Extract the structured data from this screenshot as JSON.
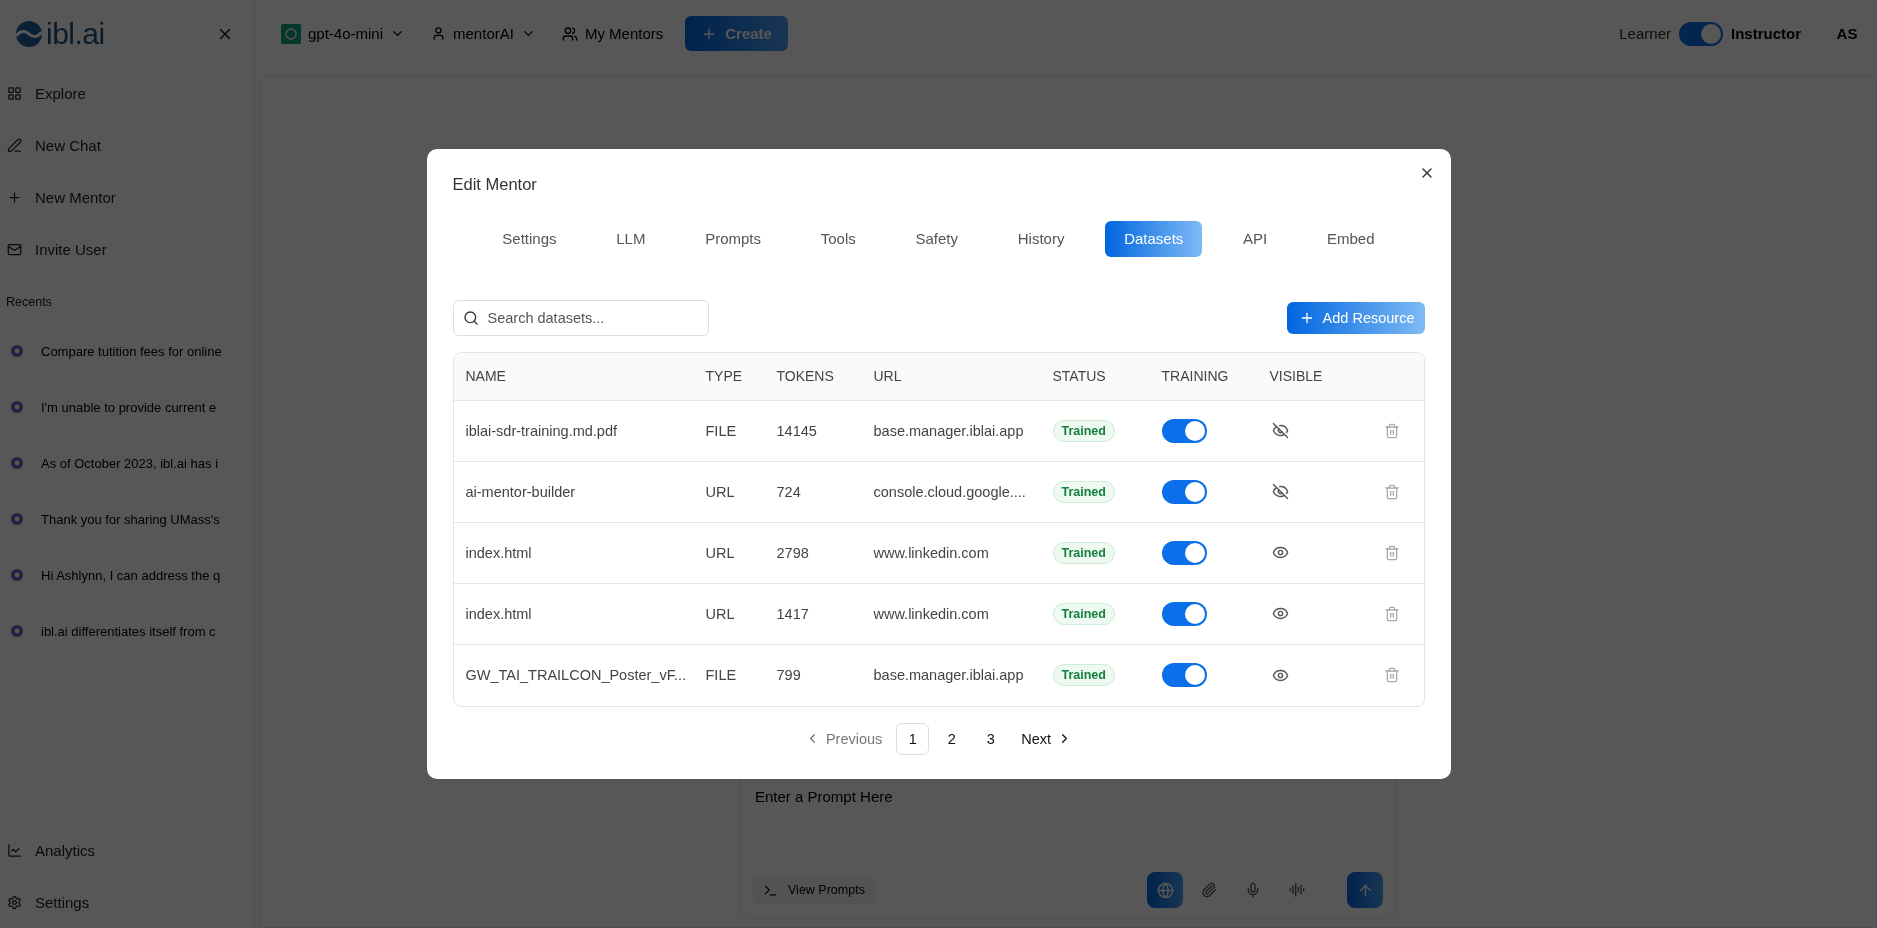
{
  "sidebar": {
    "logo": "ibl.ai",
    "nav": [
      {
        "label": "Explore"
      },
      {
        "label": "New Chat"
      },
      {
        "label": "New Mentor"
      },
      {
        "label": "Invite User"
      }
    ],
    "recents_title": "Recents",
    "recents": [
      "Compare tutition fees for online",
      "I'm unable to provide current e",
      "As of October 2023, ibl.ai has i",
      "Thank you for sharing UMass's",
      "Hi Ashlynn, I can address the q",
      "ibl.ai differentiates itself from c"
    ],
    "bottom_nav": [
      {
        "label": "Analytics"
      },
      {
        "label": "Settings"
      }
    ]
  },
  "topbar": {
    "model": "gpt-4o-mini",
    "mentor": "mentorAI",
    "my_mentors": "My Mentors",
    "create": "Create",
    "mode": {
      "learner": "Learner",
      "instructor": "Instructor",
      "on": true
    },
    "avatar": "AS"
  },
  "prompt": {
    "placeholder": "Enter a Prompt Here",
    "view_prompts": "View Prompts"
  },
  "modal": {
    "title": "Edit Mentor",
    "tabs": [
      {
        "label": "Settings",
        "selected": false
      },
      {
        "label": "LLM",
        "selected": false
      },
      {
        "label": "Prompts",
        "selected": false
      },
      {
        "label": "Tools",
        "selected": false
      },
      {
        "label": "Safety",
        "selected": false
      },
      {
        "label": "History",
        "selected": false
      },
      {
        "label": "Datasets",
        "selected": true
      },
      {
        "label": "API",
        "selected": false
      },
      {
        "label": "Embed",
        "selected": false
      }
    ],
    "search": {
      "placeholder": "Search datasets..."
    },
    "add_button": "Add Resource",
    "table": {
      "columns": [
        "NAME",
        "TYPE",
        "TOKENS",
        "URL",
        "STATUS",
        "TRAINING",
        "VISIBLE"
      ],
      "rows": [
        {
          "name": "iblai-sdr-training.md.pdf",
          "type": "FILE",
          "tokens": "14145",
          "url": "base.manager.iblai.app",
          "status": "Trained",
          "training": true,
          "visible": false
        },
        {
          "name": "ai-mentor-builder",
          "type": "URL",
          "tokens": "724",
          "url": "console.cloud.google....",
          "status": "Trained",
          "training": true,
          "visible": false
        },
        {
          "name": "index.html",
          "type": "URL",
          "tokens": "2798",
          "url": "www.linkedin.com",
          "status": "Trained",
          "training": true,
          "visible": true
        },
        {
          "name": "index.html",
          "type": "URL",
          "tokens": "1417",
          "url": "www.linkedin.com",
          "status": "Trained",
          "training": true,
          "visible": true
        },
        {
          "name": "GW_TAI_TRAILCON_Poster_vF...",
          "type": "FILE",
          "tokens": "799",
          "url": "base.manager.iblai.app",
          "status": "Trained",
          "training": true,
          "visible": true
        }
      ]
    },
    "pagination": {
      "previous": "Previous",
      "pages": [
        {
          "label": "1",
          "selected": true
        },
        {
          "label": "2",
          "selected": false
        },
        {
          "label": "3",
          "selected": false
        }
      ],
      "next": "Next"
    }
  }
}
